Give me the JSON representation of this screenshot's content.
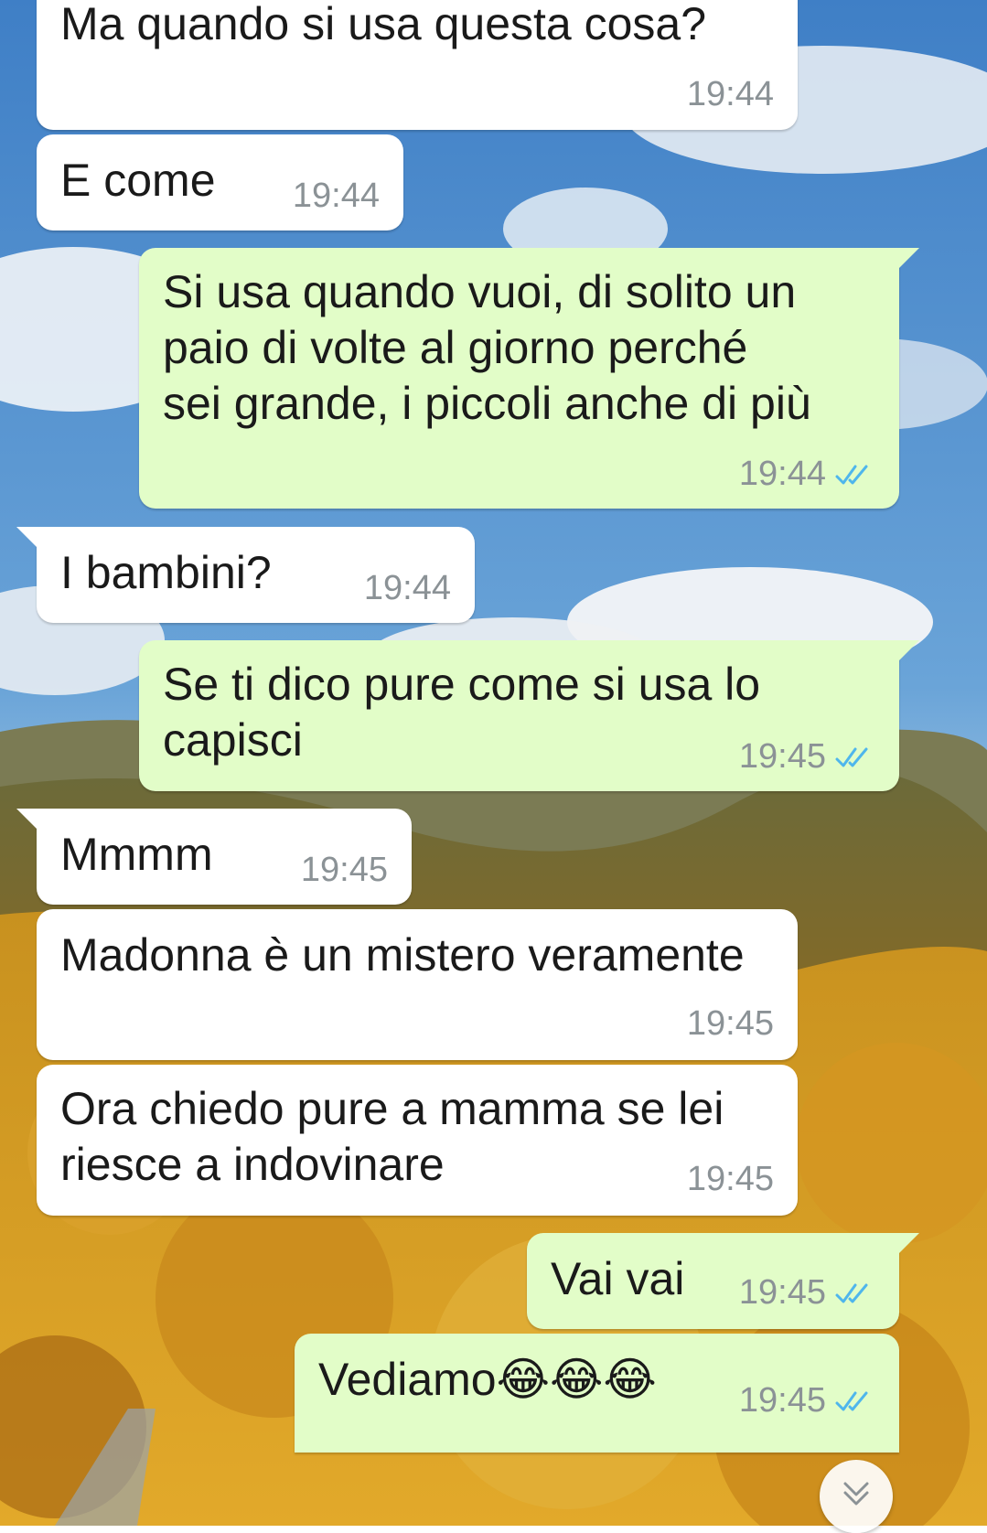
{
  "messages": [
    {
      "id": "m1",
      "dir": "in",
      "text": "Ma quando si usa questa cosa?",
      "time": "19:44"
    },
    {
      "id": "m2",
      "dir": "in",
      "text": "E come",
      "time": "19:44"
    },
    {
      "id": "m3",
      "dir": "out",
      "text": "Si usa quando vuoi, di solito un\npaio di volte al giorno perché\nsei grande, i piccoli anche di più",
      "time": "19:44",
      "status": "read"
    },
    {
      "id": "m4",
      "dir": "in",
      "text": "I bambini?",
      "time": "19:44"
    },
    {
      "id": "m5",
      "dir": "out",
      "text": "Se ti dico pure come si usa lo\ncapisci",
      "time": "19:45",
      "status": "read"
    },
    {
      "id": "m6",
      "dir": "in",
      "text": "Mmmm",
      "time": "19:45"
    },
    {
      "id": "m7",
      "dir": "in",
      "text": "Madonna è un mistero veramente",
      "time": "19:45"
    },
    {
      "id": "m8",
      "dir": "in",
      "text": "Ora chiedo pure a mamma se lei\nriesce a indovinare",
      "time": "19:45"
    },
    {
      "id": "m9",
      "dir": "out",
      "text": "Vai vai",
      "time": "19:45",
      "status": "read"
    },
    {
      "id": "m10",
      "dir": "out",
      "text": "Vediamo😂😂😂",
      "time": "19:45",
      "status": "read"
    }
  ],
  "colors": {
    "incoming": "#ffffff",
    "outgoing": "#e2fdc8",
    "read_ticks": "#4fb6ec",
    "time_text": "#8b9296"
  },
  "icons": {
    "read_status": "double-check-icon",
    "scroll_button": "chevron-down-icon"
  }
}
